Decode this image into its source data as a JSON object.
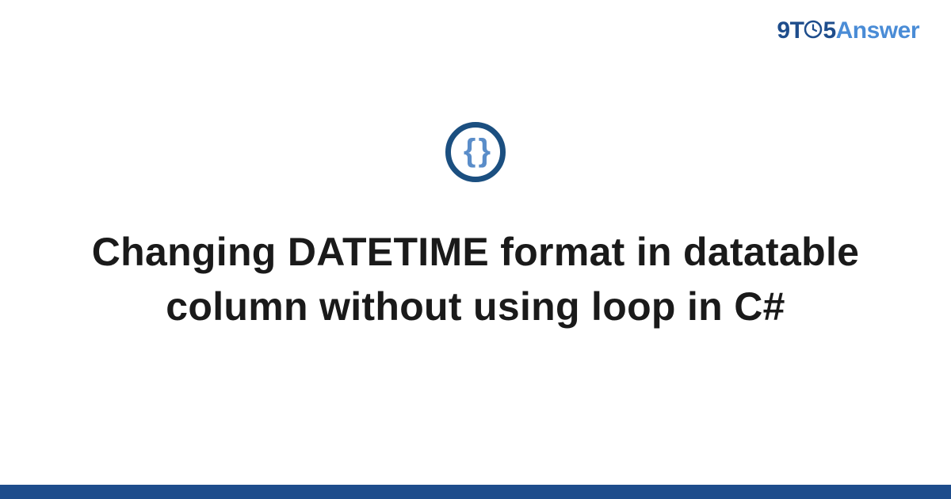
{
  "brand": {
    "nine": "9",
    "t": "T",
    "five": "5",
    "answer": "Answer"
  },
  "icon": {
    "braces": "{ }"
  },
  "title": "Changing DATETIME format in datatable column without using loop in C#"
}
